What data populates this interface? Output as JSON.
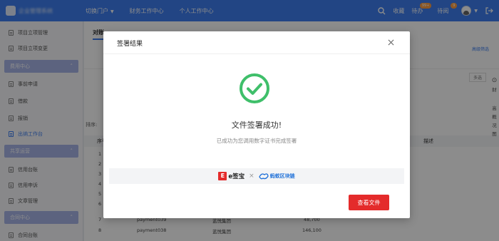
{
  "topbar": {
    "brand": "企业管理系统",
    "nav": [
      "切换门户",
      "财务工作中心",
      "个人工作中心"
    ],
    "right": {
      "favorites": "收藏",
      "todo": "待办",
      "todo_badge": "99+",
      "pending": "待阅",
      "pending_badge": "9"
    }
  },
  "sidebar": {
    "items_top": [
      "项目立项管理",
      "项目立项变更"
    ],
    "group_expense": "费用中心",
    "items_expense": [
      "事前申请",
      "借款",
      "报销",
      "出纳工作台"
    ],
    "group_shared": "共享运营",
    "items_shared": [
      "信用台账",
      "信用申诉",
      "文章管理"
    ],
    "group_contract": "合同中心",
    "items_contract": [
      "合同台账"
    ]
  },
  "main": {
    "tab": "对账",
    "advanced_filter": "高级筛选",
    "multi_select": "多选",
    "sort_label": "排序:",
    "headers": {
      "seq": "序号",
      "desc": "描述"
    },
    "rows": [
      {
        "no": "1"
      },
      {
        "no": "2"
      },
      {
        "no": "3"
      },
      {
        "no": "4"
      },
      {
        "no": "5"
      },
      {
        "no": "6"
      },
      {
        "no": "7",
        "code": "payment039",
        "org": "蓝悦集团",
        "amount": "48,700"
      },
      {
        "no": "8",
        "code": "payment038",
        "org": "蓝悦集团",
        "amount": "146,100"
      }
    ],
    "right_rail": [
      "财",
      "高",
      "概",
      "况",
      "图"
    ]
  },
  "modal": {
    "title": "签署结果",
    "success_title": "文件签署成功!",
    "success_sub": "已成功为您调用数字证书完成签署",
    "brand_esign": "e签宝",
    "brand_esign_mark": "E",
    "brand_separator": "×",
    "brand_ant": "蚂蚁区块链",
    "view_button": "查看文件"
  },
  "colors": {
    "topbar": "#3f7ff0",
    "success_green": "#3fbf6a",
    "primary_red": "#e42b2b",
    "ant_blue": "#1b6ed8"
  }
}
